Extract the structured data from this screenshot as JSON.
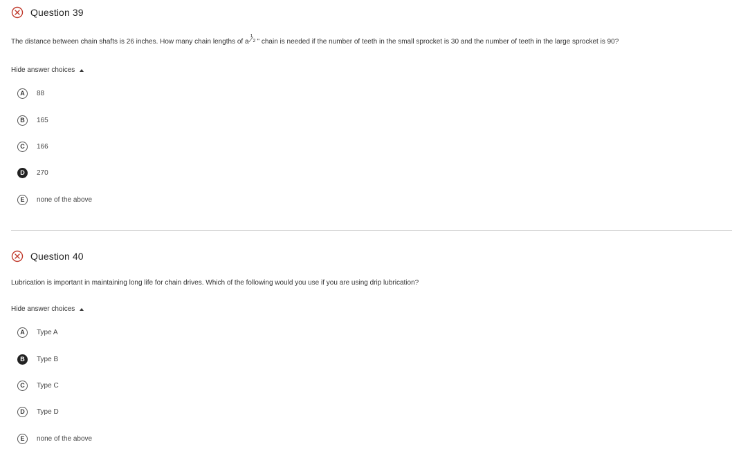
{
  "colors": {
    "incorrect_icon": "#c0392b",
    "selected_badge": "#222222",
    "divider": "#d0d0d0"
  },
  "questions": [
    {
      "title": "Question 39",
      "status_icon": "x-circle-icon",
      "text_before": "The distance between chain shafts is 26 inches. How many chain lengths of a",
      "fraction_num": "1",
      "fraction_den": "2",
      "text_after": "\" chain is needed if the number of teeth in the small sprocket is 30 and the number of teeth in the large sprocket is 90?",
      "toggle_label": "Hide answer choices",
      "choices": [
        {
          "letter": "A",
          "label": "88",
          "selected": false
        },
        {
          "letter": "B",
          "label": "165",
          "selected": false
        },
        {
          "letter": "C",
          "label": "166",
          "selected": false
        },
        {
          "letter": "D",
          "label": "270",
          "selected": true
        },
        {
          "letter": "E",
          "label": "none of the above",
          "selected": false
        }
      ]
    },
    {
      "title": "Question 40",
      "status_icon": "x-circle-icon",
      "text": "Lubrication is important in maintaining long life for chain drives. Which of the following would you use if you are using drip lubrication?",
      "toggle_label": "Hide answer choices",
      "choices": [
        {
          "letter": "A",
          "label": "Type A",
          "selected": false
        },
        {
          "letter": "B",
          "label": "Type B",
          "selected": true
        },
        {
          "letter": "C",
          "label": "Type C",
          "selected": false
        },
        {
          "letter": "D",
          "label": "Type D",
          "selected": false
        },
        {
          "letter": "E",
          "label": "none of the above",
          "selected": false
        }
      ]
    }
  ]
}
